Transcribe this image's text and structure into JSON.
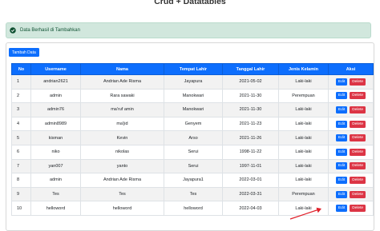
{
  "page": {
    "title": "Crud + Datatables"
  },
  "alert": {
    "message": "Data Berhasil di Tambahkan",
    "color": "#d1e7dd",
    "icon": "check-circle-icon"
  },
  "toolbar": {
    "add_label": "Tambah Data",
    "primary_color": "#0d6efd",
    "danger_color": "#dc3545"
  },
  "table": {
    "columns": [
      "No",
      "Username",
      "Nama",
      "Tempat Lahir",
      "Tanggal Lahir",
      "Jenis Kelamin",
      "Aksi"
    ],
    "edit_label": "Edit",
    "delete_label": "Delete",
    "rows": [
      {
        "no": "1",
        "username": "andrian2621",
        "nama": "Andrian Ade Risma",
        "tempat_lahir": "Jayapura",
        "tanggal_lahir": "2021-05-02",
        "jenis_kelamin": "Laki-laki"
      },
      {
        "no": "2",
        "username": "admin",
        "nama": "Rara sawaki",
        "tempat_lahir": "Manokwari",
        "tanggal_lahir": "2021-11-30",
        "jenis_kelamin": "Perempuan"
      },
      {
        "no": "3",
        "username": "admin76",
        "nama": "ma'ruf amin",
        "tempat_lahir": "Manokwari",
        "tanggal_lahir": "2021-11-30",
        "jenis_kelamin": "Laki-laki"
      },
      {
        "no": "4",
        "username": "admin8989",
        "nama": "ma'jid",
        "tempat_lahir": "Genyem",
        "tanggal_lahir": "2021-11-23",
        "jenis_kelamin": "Laki-laki"
      },
      {
        "no": "5",
        "username": "kisman",
        "nama": "Kevin",
        "tempat_lahir": "Arso",
        "tanggal_lahir": "2021-11-26",
        "jenis_kelamin": "Laki-laki"
      },
      {
        "no": "6",
        "username": "niko",
        "nama": "nikolas",
        "tempat_lahir": "Serui",
        "tanggal_lahir": "1998-11-22",
        "jenis_kelamin": "Laki-laki"
      },
      {
        "no": "7",
        "username": "yan007",
        "nama": "yanto",
        "tempat_lahir": "Serui",
        "tanggal_lahir": "1997-11-01",
        "jenis_kelamin": "Laki-laki"
      },
      {
        "no": "8",
        "username": "admin",
        "nama": "Andrian Ade Risma",
        "tempat_lahir": "Jayapura1",
        "tanggal_lahir": "2022-03-01",
        "jenis_kelamin": "Laki-laki"
      },
      {
        "no": "9",
        "username": "Tes",
        "nama": "Tes",
        "tempat_lahir": "Tes",
        "tanggal_lahir": "2022-03-31",
        "jenis_kelamin": "Perempuan"
      },
      {
        "no": "10",
        "username": "helloword",
        "nama": "helloword",
        "tempat_lahir": "helloword",
        "tanggal_lahir": "2022-04-03",
        "jenis_kelamin": "Laki-laki"
      }
    ]
  },
  "annotation": {
    "arrow_color": "#e0202a",
    "icon": "arrow-icon"
  }
}
